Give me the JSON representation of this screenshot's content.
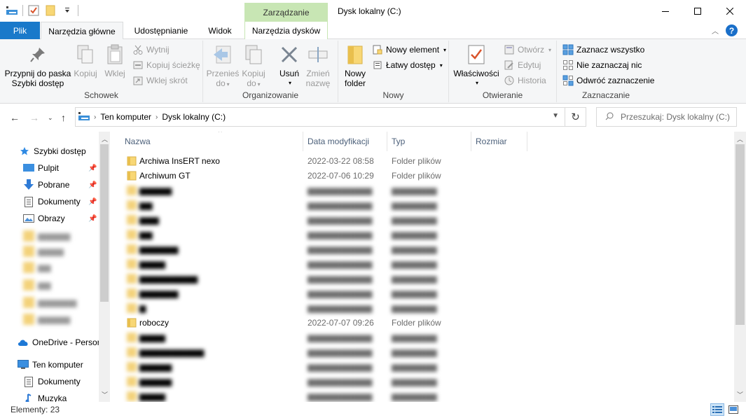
{
  "window": {
    "title": "Dysk lokalny (C:)",
    "context_group": "Zarządzanie"
  },
  "tabs": {
    "file": "Plik",
    "home": "Narzędzia główne",
    "share": "Udostępnianie",
    "view": "Widok",
    "disk_tools": "Narzędzia dysków"
  },
  "ribbon": {
    "clipboard": {
      "label": "Schowek",
      "pin_line1": "Przypnij do paska",
      "pin_line2": "Szybki dostęp",
      "copy": "Kopiuj",
      "paste": "Wklej",
      "cut": "Wytnij",
      "copy_path": "Kopiuj ścieżkę",
      "paste_shortcut": "Wklej skrót"
    },
    "organize": {
      "label": "Organizowanie",
      "move_line1": "Przenieś",
      "move_line2": "do",
      "copy_line1": "Kopiuj",
      "copy_line2": "do",
      "delete": "Usuń",
      "rename_line1": "Zmień",
      "rename_line2": "nazwę"
    },
    "new": {
      "label": "Nowy",
      "folder_line1": "Nowy",
      "folder_line2": "folder",
      "new_item": "Nowy element",
      "easy_access": "Łatwy dostęp"
    },
    "open": {
      "label": "Otwieranie",
      "properties": "Właściwości",
      "open": "Otwórz",
      "edit": "Edytuj",
      "history": "Historia"
    },
    "select": {
      "label": "Zaznaczanie",
      "select_all": "Zaznacz wszystko",
      "select_none": "Nie zaznaczaj nic",
      "invert": "Odwróć zaznaczenie"
    }
  },
  "address": {
    "crumbs": [
      "Ten komputer",
      "Dysk lokalny (C:)"
    ],
    "search_placeholder": "Przeszukaj: Dysk lokalny (C:)"
  },
  "nav": {
    "quick_access": "Szybki dostęp",
    "pinned": [
      "Pulpit",
      "Pobrane",
      "Dokumenty",
      "Obrazy"
    ],
    "onedrive": "OneDrive - Persor",
    "this_pc": "Ten komputer",
    "pc_items": [
      "Dokumenty",
      "Muzyka"
    ]
  },
  "columns": {
    "name": "Nazwa",
    "date": "Data modyfikacji",
    "type": "Typ",
    "size": "Rozmiar"
  },
  "rows": [
    {
      "name": "Archiwa InsERT nexo",
      "date": "2022-03-22 08:58",
      "type": "Folder plików"
    },
    {
      "name": "Archiwum GT",
      "date": "2022-07-06 10:29",
      "type": "Folder plików"
    },
    {
      "name": "roboczy",
      "date": "2022-07-07 09:26",
      "type": "Folder plików"
    }
  ],
  "status": {
    "items": "Elementy: 23"
  },
  "colors": {
    "accent": "#1979ca",
    "context": "#c8e6b4",
    "folder": "#f8d775"
  }
}
